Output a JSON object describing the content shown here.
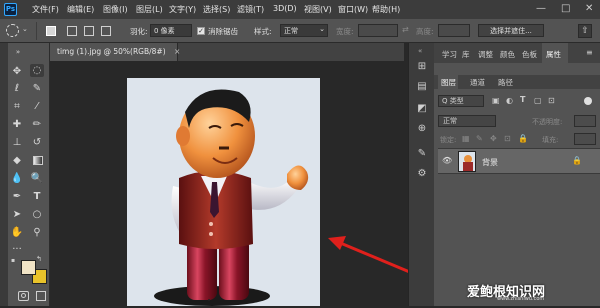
{
  "app": {
    "logo": "Ps"
  },
  "menu": [
    "文件(F)",
    "编辑(E)",
    "图像(I)",
    "图层(L)",
    "文字(Y)",
    "选择(S)",
    "滤镜(T)",
    "3D(D)",
    "视图(V)",
    "窗口(W)",
    "帮助(H)"
  ],
  "window_controls": {
    "minimize": "—",
    "restore": "□",
    "close": "✕"
  },
  "options": {
    "feather_label": "羽化:",
    "feather_value": "0 像素",
    "antialias_label": "消除锯齿",
    "style_label": "样式:",
    "style_value": "正常",
    "width_label": "宽度:",
    "height_label": "高度:",
    "select_mask_button": "选择并遮住..."
  },
  "document": {
    "tab_title": "timg (1).jpg @ 50%(RGB/8#)",
    "close": "×"
  },
  "panels": {
    "top_tabs": [
      "学习",
      "库",
      "调整",
      "颜色",
      "色板",
      "属性"
    ],
    "layer_tabs": [
      "图层",
      "通道",
      "路径"
    ],
    "kind_label": "Q 类型",
    "blend_mode": "正常",
    "opacity_label": "不透明度:",
    "lock_label": "锁定:",
    "fill_label": "填充:",
    "layer_name": "背景"
  },
  "colors": {
    "foreground": "#f1e4c6",
    "background": "#e9c32a"
  },
  "watermark": {
    "text": "爱鲍根知识网",
    "url": "www.zhishiwu.com"
  }
}
